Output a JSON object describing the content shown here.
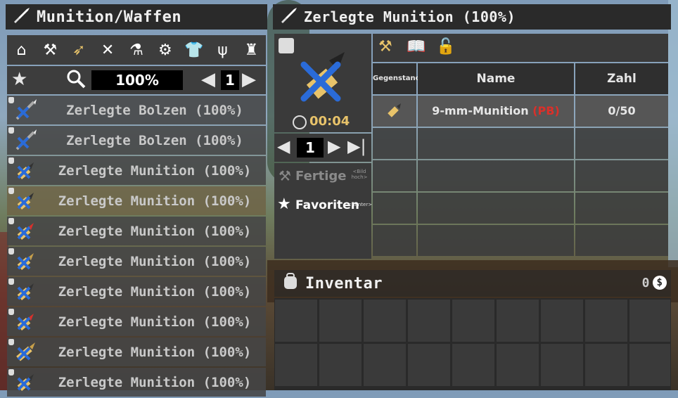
{
  "left_panel": {
    "title": "Munition/Waffen",
    "categories": [
      "home-icon",
      "workbench-icon",
      "ammo-icon",
      "tools-icon",
      "microscope-icon",
      "gears-icon",
      "shirt-icon",
      "fork-icon",
      "chair-icon"
    ],
    "filter": {
      "percent": "100%",
      "page": "1"
    },
    "recipes": [
      {
        "label": "Zerlegte Bolzen (100%)",
        "icon": "bolt"
      },
      {
        "label": "Zerlegte Bolzen (100%)",
        "icon": "bolt"
      },
      {
        "label": "Zerlegte Munition (100%)",
        "icon": "bullet"
      },
      {
        "label": "Zerlegte Munition (100%)",
        "icon": "bullet"
      },
      {
        "label": "Zerlegte Munition (100%)",
        "icon": "bullet-red"
      },
      {
        "label": "Zerlegte Munition (100%)",
        "icon": "bullet"
      },
      {
        "label": "Zerlegte Munition (100%)",
        "icon": "bullet"
      },
      {
        "label": "Zerlegte Munition (100%)",
        "icon": "bullet-red"
      },
      {
        "label": "Zerlegte Munition (100%)",
        "icon": "bullet"
      },
      {
        "label": "Zerlegte Munition (100%)",
        "icon": "bullet"
      }
    ]
  },
  "right_panel": {
    "title": "Zerlegte Munition (100%)",
    "craft_time": "00:04",
    "quantity": "1",
    "fertige": "Fertige",
    "bild_hoch": "<Bild hoch>",
    "favoriten": "Favoriten",
    "runter": "<Runter>",
    "columns": {
      "gegenstand": "Gegenstand",
      "name": "Name",
      "zahl": "Zahl"
    },
    "ingredient": {
      "name": "9-mm-Munition ",
      "tag": "(PB)",
      "count": "0/50"
    }
  },
  "inventory": {
    "title": "Inventar",
    "coins": "0"
  },
  "colors": {
    "tag_red": "#d9302a",
    "gold": "#e8c36a",
    "blue": "#2a6bd8"
  }
}
